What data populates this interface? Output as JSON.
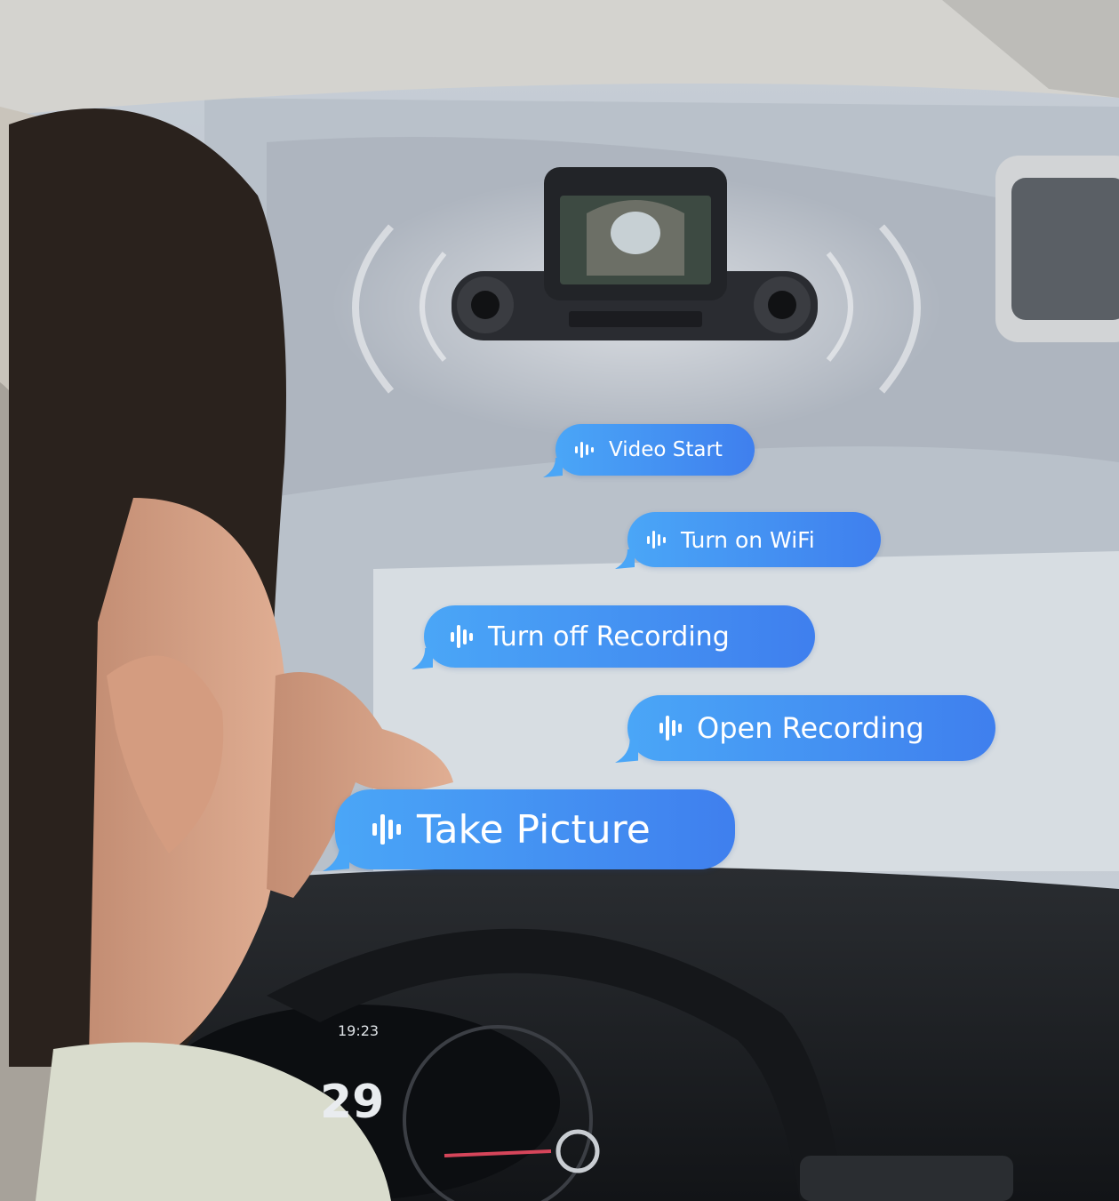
{
  "colors": {
    "bubble_start": "#4aa6f7",
    "bubble_end": "#3f7fee",
    "bubble_text": "#ffffff"
  },
  "icons": {
    "voice": "voice-wave-icon",
    "device": "dash-cam-icon"
  },
  "bubbles": [
    {
      "label": "Video Start"
    },
    {
      "label": "Turn on WiFi"
    },
    {
      "label": "Turn off Recording"
    },
    {
      "label": "Open Recording"
    },
    {
      "label": "Take Picture"
    }
  ],
  "dashboard": {
    "clock": "19:23",
    "speed": "29"
  }
}
